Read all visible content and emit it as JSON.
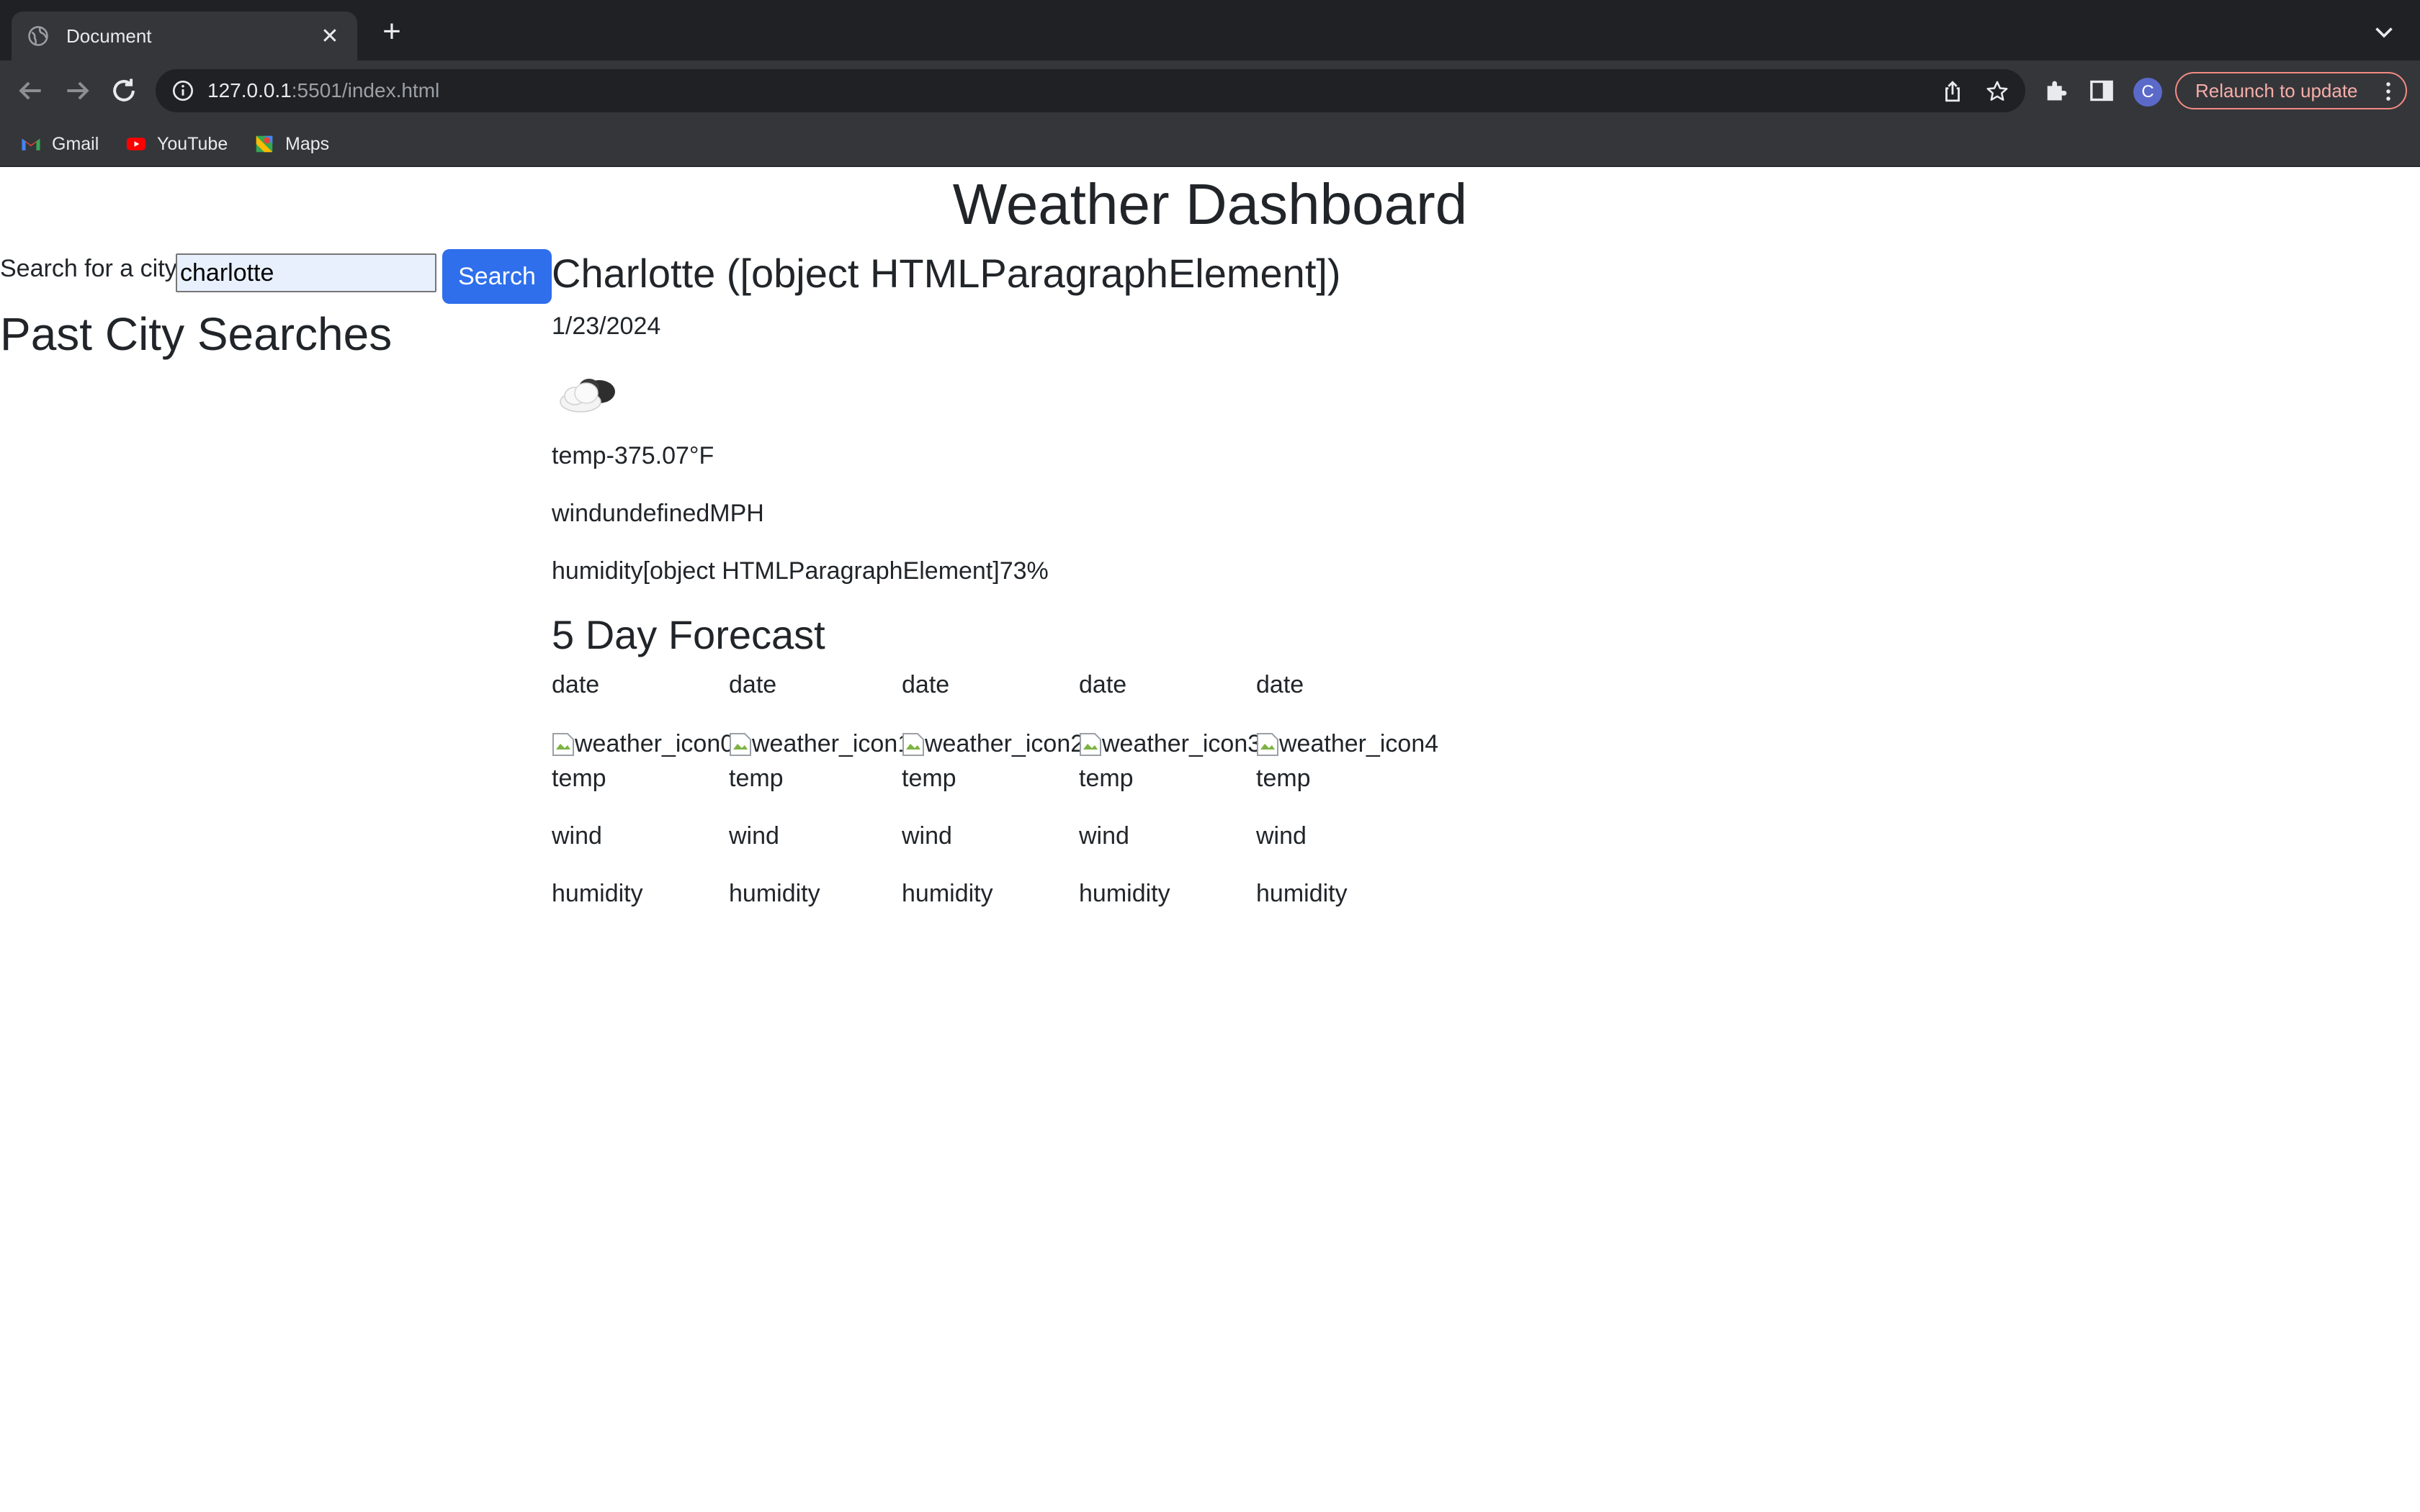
{
  "browser": {
    "tab_title": "Document",
    "url_host": "127.0.0.1",
    "url_rest": ":5501/index.html",
    "avatar_letter": "C",
    "relaunch_label": "Relaunch to update",
    "bookmarks": [
      "Gmail",
      "YouTube",
      "Maps"
    ]
  },
  "page": {
    "title": "Weather Dashboard",
    "search_label": "Search for a city",
    "search_value": "charlotte",
    "search_button": "Search",
    "past_searches_title": "Past City Searches"
  },
  "current": {
    "city_heading": "Charlotte ([object HTMLParagraphElement])",
    "date": "1/23/2024",
    "icon": "cloud-icon",
    "temp": "temp-375.07°F",
    "wind": "windundefinedMPH",
    "humidity": "humidity[object HTMLParagraphElement]73%"
  },
  "forecast": {
    "title": "5 Day Forecast",
    "days": [
      {
        "date": "date",
        "icon_alt": "weather_icon0",
        "temp": "temp",
        "wind": "wind",
        "humidity": "humidity"
      },
      {
        "date": "date",
        "icon_alt": "weather_icon1",
        "temp": "temp",
        "wind": "wind",
        "humidity": "humidity"
      },
      {
        "date": "date",
        "icon_alt": "weather_icon2",
        "temp": "temp",
        "wind": "wind",
        "humidity": "humidity"
      },
      {
        "date": "date",
        "icon_alt": "weather_icon3",
        "temp": "temp",
        "wind": "wind",
        "humidity": "humidity"
      },
      {
        "date": "date",
        "icon_alt": "weather_icon4",
        "temp": "temp",
        "wind": "wind",
        "humidity": "humidity"
      }
    ]
  },
  "colors": {
    "chrome_dark": "#202124",
    "chrome_toolbar": "#35363a",
    "search_button": "#2f6fec",
    "relaunch_accent": "#f28b82",
    "text": "#212529"
  }
}
